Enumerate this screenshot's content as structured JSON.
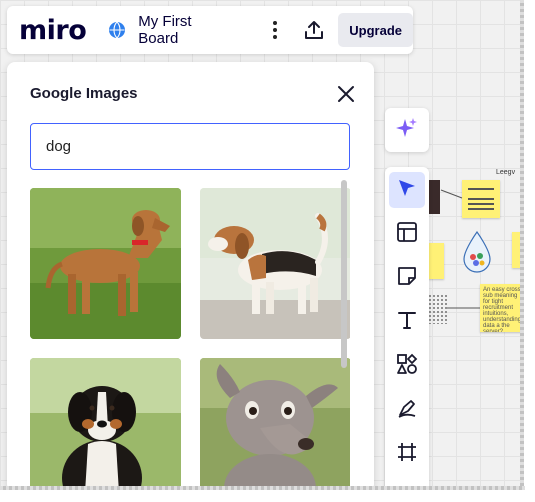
{
  "app": {
    "logo_text": "miro",
    "board_name": "My First Board",
    "upgrade_label": "Upgrade",
    "brand_color": "#050038",
    "accent_color": "#4262ff"
  },
  "topbar": {
    "icons": [
      "globe-icon",
      "more-vertical-icon",
      "upload-icon"
    ]
  },
  "panel": {
    "title": "Google Images",
    "search_value": "dog",
    "close_icon": "close-icon",
    "results": [
      {
        "subject": "tan dog standing on grass"
      },
      {
        "subject": "beagle standing side view"
      },
      {
        "subject": "bernese puppy on grass"
      },
      {
        "subject": "hairless dog close-up"
      }
    ]
  },
  "toolbar": {
    "ai_icon": "sparkle-icon",
    "tools": [
      {
        "name": "select",
        "icon": "cursor-arrow-icon",
        "active": true
      },
      {
        "name": "templates",
        "icon": "layout-icon",
        "active": false
      },
      {
        "name": "sticky-note",
        "icon": "sticky-note-icon",
        "active": false
      },
      {
        "name": "text",
        "icon": "text-icon",
        "active": false
      },
      {
        "name": "shapes",
        "icon": "shapes-icon",
        "active": false
      },
      {
        "name": "pen",
        "icon": "pen-icon",
        "active": false
      },
      {
        "name": "frame",
        "icon": "frame-icon",
        "active": false
      }
    ]
  },
  "board": {
    "label_fragment": "Leegv",
    "note_text": "An easy cross sub meaning for tight recruitment intuitions, understanding data a the server?"
  }
}
